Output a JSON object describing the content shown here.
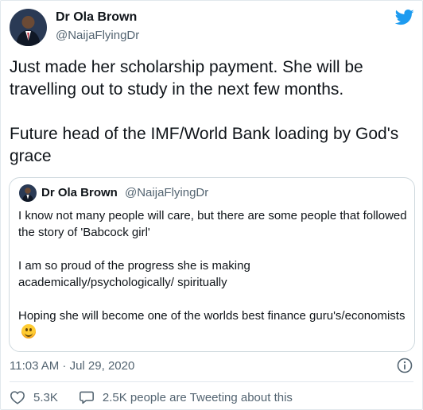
{
  "author": {
    "name": "Dr Ola Brown",
    "handle": "@NaijaFlyingDr"
  },
  "tweet": {
    "text": "Just made her scholarship payment. She will be travelling out to study in the next few months.\n\nFuture head of the IMF/World Bank loading by God's grace"
  },
  "quoted": {
    "name": "Dr Ola Brown",
    "handle": "@NaijaFlyingDr",
    "text": "I know not many people will care, but there are some people that followed the story of 'Babcock girl'\n\nI am so proud of the progress she is making academically/psychologically/ spiritually\n\nHoping she will become one of the worlds best finance guru's/economists"
  },
  "timestamp": "11:03 AM · Jul 29, 2020",
  "actions": {
    "likes": "5.3K",
    "discussion": "2.5K people are Tweeting about this"
  },
  "icons": {
    "brand": "twitter-bird-icon",
    "info": "info-icon",
    "like": "heart-icon",
    "comment": "speech-bubble-icon",
    "emoji": "smiling-face-emoji"
  },
  "colors": {
    "brand": "#1d9bf0",
    "muted": "#536471",
    "text": "#0f1419",
    "border": "#cfd9de"
  }
}
